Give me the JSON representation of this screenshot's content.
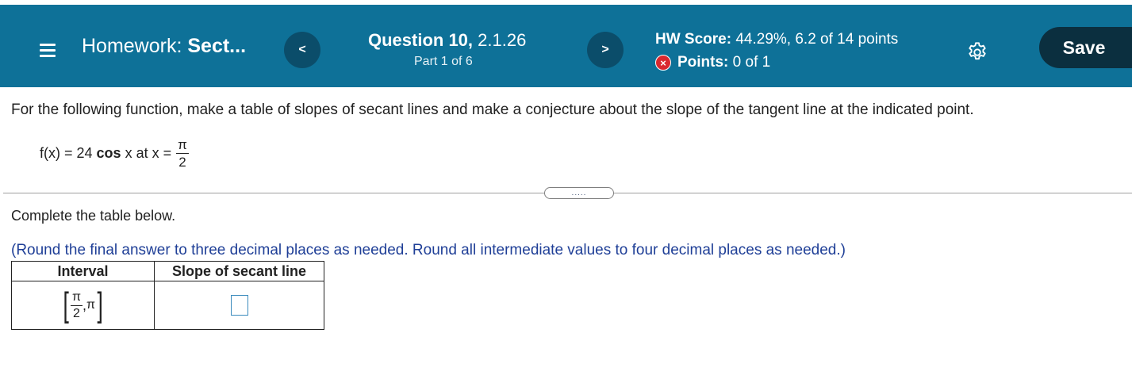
{
  "header": {
    "hw_prefix": "Homework: ",
    "hw_name": "Sect...",
    "prev_label": "<",
    "next_label": ">",
    "question_label": "Question 10,",
    "question_id": " 2.1.26",
    "part": "Part 1 of 6",
    "score_label": "HW Score:",
    "score_value": " 44.29%, 6.2 of 14 points",
    "points_label": "Points:",
    "points_value": " 0 of 1",
    "x_glyph": "×",
    "save_label": "Save",
    "colors": {
      "bar": "#0e7198",
      "nav_button": "#0b4d6a",
      "save_button": "#0b2f3f",
      "error": "#d9282f"
    },
    "icons": [
      "menu-icon",
      "chevron-left-icon",
      "chevron-right-icon",
      "x-circle-icon",
      "gear-icon"
    ]
  },
  "question": {
    "instruction": "For the following function, make a table of slopes of secant lines and make a conjecture about the slope of the tangent line at the indicated point.",
    "function_prefix": "f(x) = 24 ",
    "function_cos": "cos",
    "function_suffix": " x at x =",
    "frac_num": "π",
    "frac_den": "2",
    "expand_label": ".....",
    "complete_label": "Complete the table below.",
    "round_note": "(Round the final answer to three decimal places as needed. Round all intermediate values to four decimal places as needed.)",
    "note_color": "#1f3f97"
  },
  "table": {
    "headers": [
      "Interval",
      "Slope of secant line"
    ],
    "rows": [
      {
        "interval_num": "π",
        "interval_den": "2",
        "interval_sep": ",",
        "interval_end": "π",
        "slope_value": ""
      }
    ]
  }
}
